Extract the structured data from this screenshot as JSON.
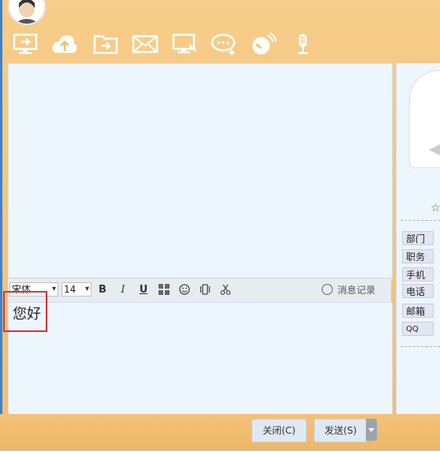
{
  "toolbar": {
    "icons": [
      "screen-share-icon",
      "upload-cloud-icon",
      "folder-transfer-icon",
      "mail-icon",
      "remote-screen-icon",
      "chat-add-icon",
      "whiteboard-icon",
      "microphone-icon"
    ]
  },
  "format_bar": {
    "font": "宋体",
    "size": "14",
    "bold": "B",
    "italic": "I",
    "underline": "U",
    "history_label": "消息记录"
  },
  "input": {
    "text": "您好"
  },
  "contact": {
    "star": "☆",
    "fields": [
      "部门",
      "职务",
      "手机",
      "电话",
      "邮箱",
      "QQ"
    ]
  },
  "buttons": {
    "close_label": "关闭(C)",
    "send_label": "发送(S)"
  },
  "colors": {
    "frame": "#f2bd73",
    "panel": "#eef6fd",
    "highlight": "#e03030"
  }
}
